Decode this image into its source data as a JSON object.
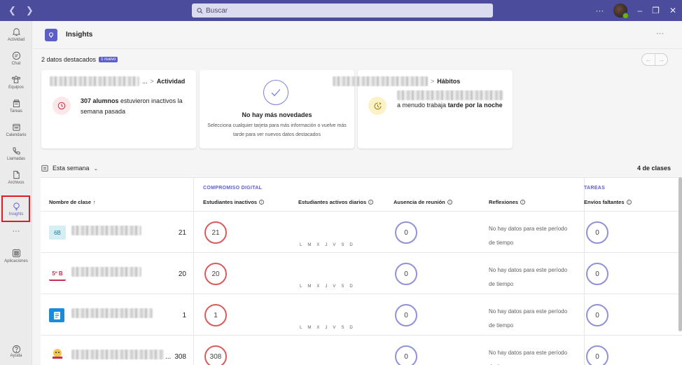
{
  "titlebar": {
    "back_icon": "chevron-left-icon",
    "forward_icon": "chevron-right-icon",
    "search_placeholder": "Buscar",
    "more": "···",
    "minimize": "–",
    "maximize": "❐",
    "close": "✕"
  },
  "rail": {
    "items": [
      {
        "label": "Actividad",
        "icon": "bell-icon"
      },
      {
        "label": "Chat",
        "icon": "chat-icon"
      },
      {
        "label": "Equipos",
        "icon": "teams-icon"
      },
      {
        "label": "Tareas",
        "icon": "assignments-icon"
      },
      {
        "label": "Calendario",
        "icon": "calendar-icon"
      },
      {
        "label": "Llamadas",
        "icon": "phone-icon"
      },
      {
        "label": "Archivos",
        "icon": "file-icon"
      },
      {
        "label": "Insights",
        "icon": "insights-icon"
      },
      {
        "label": "Aplicaciones",
        "icon": "apps-icon"
      }
    ],
    "more": "···",
    "help": "Ayuda"
  },
  "header": {
    "title": "Insights",
    "more": "···"
  },
  "highlights": {
    "title": "2 datos destacados",
    "badge": "1 nuevo",
    "cards": [
      {
        "truncation": "...",
        "category": "Actividad",
        "text_bold": "307 alumnos",
        "text_rest": " estuvieron inactivos la semana pasada"
      },
      {
        "title": "No hay más novedades",
        "subtitle": "Selecciona cualquier tarjeta para más información o vuelve más tarde para ver nuevos datos destacados"
      },
      {
        "category": "Hábitos",
        "text_pre": "a menudo trabaja ",
        "text_bold": "tarde por la noche"
      }
    ]
  },
  "week": {
    "label": "Esta semana",
    "classes_count": "4 de clases"
  },
  "table": {
    "group_digital": "COMPROMISO DIGITAL",
    "group_tasks": "TAREAS",
    "headers": {
      "class_name": "Nombre de clase",
      "sort_arrow": "↑",
      "inactive": "Estudiantes inactivos",
      "daily_active": "Estudiantes activos diarios",
      "meeting_absence": "Ausencia de reunión",
      "reflections": "Reflexiones",
      "missing": "Envíos faltantes"
    },
    "days": [
      "L",
      "M",
      "X",
      "J",
      "V",
      "S",
      "D"
    ],
    "no_data": "No hay datos para este período de tiempo",
    "rows": [
      {
        "icon_text": "6B",
        "count": "21",
        "inactive": "21",
        "absence": "0",
        "missing": "0"
      },
      {
        "icon_text": "5º B",
        "count": "20",
        "inactive": "20",
        "absence": "0",
        "missing": "0"
      },
      {
        "icon_text": "",
        "count": "1",
        "inactive": "1",
        "absence": "0",
        "missing": "0"
      },
      {
        "icon_text": "",
        "truncation": "...",
        "count": "308",
        "inactive": "308",
        "absence": "0",
        "missing": "0"
      }
    ]
  },
  "colors": {
    "titlebar": "#4b4c9c",
    "accent": "#5b5fc7",
    "inactive_ring": "#d85c5c",
    "neutral_ring": "#8f92d6",
    "highlight_box": "#e21b23"
  }
}
